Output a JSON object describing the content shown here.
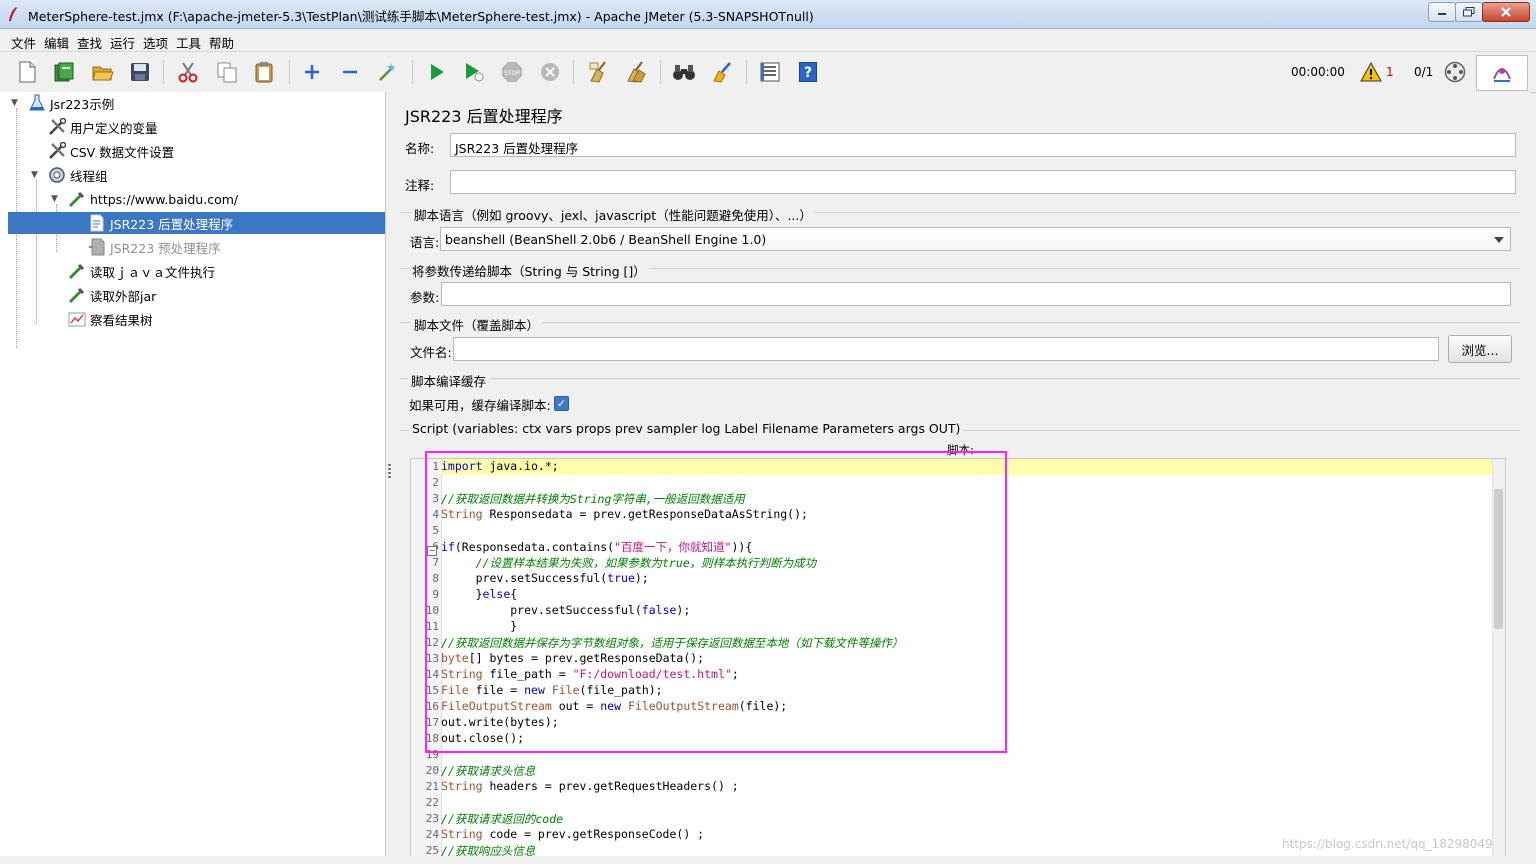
{
  "window": {
    "title": "MeterSphere-test.jmx (F:\\apache-jmeter-5.3\\TestPlan\\测试练手脚本\\MeterSphere-test.jmx) - Apache JMeter (5.3-SNAPSHOTnull)"
  },
  "menu": [
    "文件",
    "编辑",
    "查找",
    "运行",
    "选项",
    "工具",
    "帮助"
  ],
  "toolbar": {
    "timer": "00:00:00",
    "warning_count": "1",
    "threads": "0/1"
  },
  "tree": {
    "root": "Jsr223示例",
    "user_vars": "用户定义的变量",
    "csv": "CSV 数据文件设置",
    "thread_group": "线程组",
    "sampler": "https://www.baidu.com/",
    "post_processor": "JSR223 后置处理程序",
    "pre_processor": "JSR223 预处理程序",
    "read_java": "读取ｊａｖａ文件执行",
    "read_jar": "读取外部jar",
    "result_tree": "察看结果树"
  },
  "panel": {
    "heading": "JSR223 后置处理程序",
    "name_label": "名称:",
    "name_value": "JSR223 后置处理程序",
    "comment_label": "注释:",
    "comment_value": "",
    "lang_group": "脚本语言（例如 groovy、jexl、javascript（性能问题避免使用）、...）",
    "lang_label": "语言:",
    "lang_value": "beanshell     (BeanShell 2.0b6 / BeanShell Engine 1.0)",
    "params_group": "将参数传递给脚本（String 与 String []）",
    "params_label": "参数:",
    "params_value": "",
    "file_group": "脚本文件（覆盖脚本）",
    "file_label": "文件名:",
    "file_value": "",
    "browse_button": "浏览...",
    "cache_group": "脚本编译缓存",
    "cache_label": "如果可用，缓存编译脚本:",
    "script_vars": "Script (variables: ctx vars props prev sampler log Label Filename Parameters args OUT)",
    "script_label": "脚本:"
  },
  "code_lines": [
    {
      "n": "1",
      "html": "<span class=\"kw\">import</span> java.io.*;"
    },
    {
      "n": "2",
      "html": ""
    },
    {
      "n": "3",
      "html": "<span class=\"cm\">//获取返回数据并转换为String字符串,一般返回数据适用</span>"
    },
    {
      "n": "4",
      "html": "<span class=\"ty\">String</span> Responsedata = prev.getResponseDataAsString();"
    },
    {
      "n": "5",
      "html": ""
    },
    {
      "n": "6",
      "html": "<span class=\"kw\">if</span>(Responsedata.contains(<span class=\"st\">\"百度一下，你就知道\"</span>)){"
    },
    {
      "n": "7",
      "html": "     <span class=\"cm\">//设置样本结果为失败，如果参数为true，则样本执行判断为成功</span>"
    },
    {
      "n": "8",
      "html": "     prev.setSuccessful(<span class=\"kw\">true</span>);"
    },
    {
      "n": "9",
      "html": "     }<span class=\"kw\">else</span>{"
    },
    {
      "n": "10",
      "html": "          prev.setSuccessful(<span class=\"kw\">false</span>);"
    },
    {
      "n": "11",
      "html": "          }"
    },
    {
      "n": "12",
      "html": "<span class=\"cm\">//获取返回数据并保存为字节数组对象，适用于保存返回数据至本地（如下载文件等操作）</span>"
    },
    {
      "n": "13",
      "html": "<span class=\"ty\">byte</span>[] bytes = prev.getResponseData();"
    },
    {
      "n": "14",
      "html": "<span class=\"ty\">String</span> file_path = <span class=\"st\">\"F:/download/test.html\"</span>;"
    },
    {
      "n": "15",
      "html": "<span class=\"ty\">File</span> file = <span class=\"kw\">new</span> <span class=\"ty\">File</span>(file_path);"
    },
    {
      "n": "16",
      "html": "<span class=\"ty\">FileOutputStream</span> out = <span class=\"kw\">new</span> <span class=\"ty\">FileOutputStream</span>(file);"
    },
    {
      "n": "17",
      "html": "out.write(bytes);"
    },
    {
      "n": "18",
      "html": "out.close();"
    },
    {
      "n": "19",
      "html": ""
    },
    {
      "n": "20",
      "html": "<span class=\"cm\">//获取请求头信息</span>"
    },
    {
      "n": "21",
      "html": "<span class=\"ty\">String</span> headers = prev.getRequestHeaders() ;"
    },
    {
      "n": "22",
      "html": ""
    },
    {
      "n": "23",
      "html": "<span class=\"cm\">//获取请求返回的code</span>"
    },
    {
      "n": "24",
      "html": "<span class=\"ty\">String</span> code = prev.getResponseCode() ;"
    },
    {
      "n": "25",
      "html": "<span class=\"cm\">//获取响应头信息</span>"
    }
  ],
  "watermark": "https://blog.csdn.net/qq_18298049"
}
